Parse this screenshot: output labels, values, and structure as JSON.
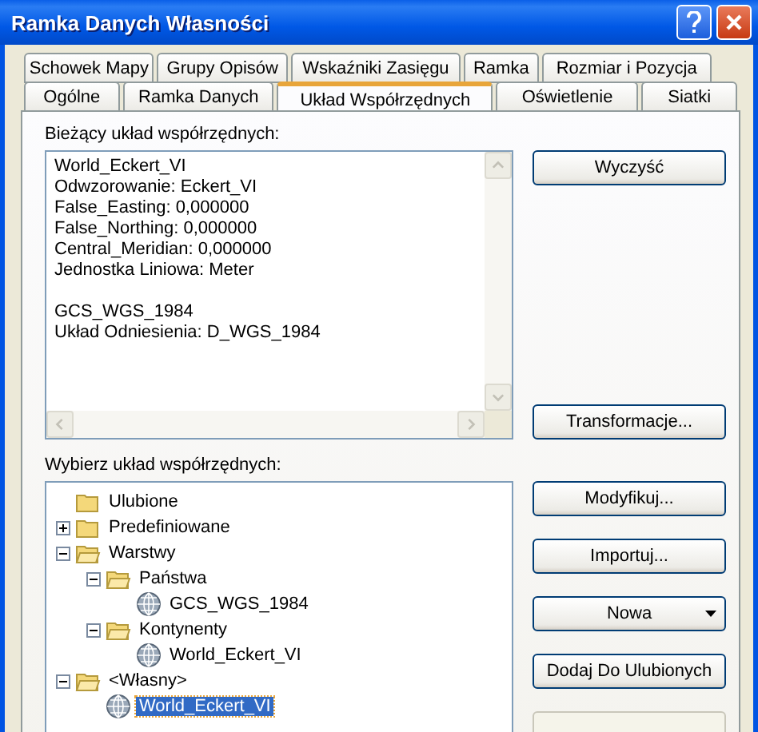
{
  "window": {
    "title": "Ramka Danych Własności"
  },
  "tab_rows": [
    [
      {
        "label": "Schowek Mapy",
        "selected": false
      },
      {
        "label": "Grupy Opisów",
        "selected": false
      },
      {
        "label": "Wskaźniki Zasięgu",
        "selected": false
      },
      {
        "label": "Ramka",
        "selected": false
      },
      {
        "label": "Rozmiar i Pozycja",
        "selected": false
      }
    ],
    [
      {
        "label": "Ogólne",
        "selected": false
      },
      {
        "label": "Ramka Danych",
        "selected": false
      },
      {
        "label": "Układ Współrzędnych",
        "selected": true
      },
      {
        "label": "Oświetlenie",
        "selected": false
      },
      {
        "label": "Siatki",
        "selected": false
      }
    ]
  ],
  "current": {
    "label": "Bieżący układ współrzędnych:",
    "paragraphs": [
      [
        "World_Eckert_VI",
        "Odwzorowanie: Eckert_VI",
        "False_Easting: 0,000000",
        "False_Northing: 0,000000",
        "Central_Meridian: 0,000000",
        "Jednostka Liniowa: Meter"
      ],
      [
        "GCS_WGS_1984",
        "Układ Odniesienia: D_WGS_1984"
      ]
    ],
    "buttons": [
      {
        "label": "Wyczyść",
        "disabled": false
      },
      {
        "label": "Transformacje...",
        "disabled": false
      }
    ]
  },
  "select": {
    "label": "Wybierz układ współrzędnych:",
    "tree": [
      {
        "label": "Ulubione",
        "kind": "folder",
        "selected": false
      },
      {
        "label": "Predefiniowane",
        "kind": "folder",
        "expanded": false,
        "selected": false
      },
      {
        "label": "Warstwy",
        "kind": "folder",
        "expanded": true,
        "selected": false,
        "children": [
          {
            "label": "Państwa",
            "kind": "folder",
            "expanded": true,
            "selected": false,
            "children": [
              {
                "label": "GCS_WGS_1984",
                "kind": "globe",
                "selected": false
              }
            ]
          },
          {
            "label": "Kontynenty",
            "kind": "folder",
            "expanded": true,
            "selected": false,
            "children": [
              {
                "label": "World_Eckert_VI",
                "kind": "globe",
                "selected": false
              }
            ]
          }
        ]
      },
      {
        "label": "<Własny>",
        "kind": "folder",
        "expanded": true,
        "selected": false,
        "children": [
          {
            "label": "World_Eckert_VI",
            "kind": "globe",
            "selected": true
          }
        ]
      }
    ],
    "buttons": [
      {
        "label": "Modyfikuj...",
        "kind": "plain",
        "disabled": false
      },
      {
        "label": "Importuj...",
        "kind": "plain",
        "disabled": false
      },
      {
        "label": "Nowa",
        "kind": "dropdown",
        "disabled": false
      },
      {
        "label": "Dodaj Do Ulubionych",
        "kind": "plain",
        "disabled": false
      },
      {
        "kind": "plain",
        "disabled": true
      }
    ]
  }
}
